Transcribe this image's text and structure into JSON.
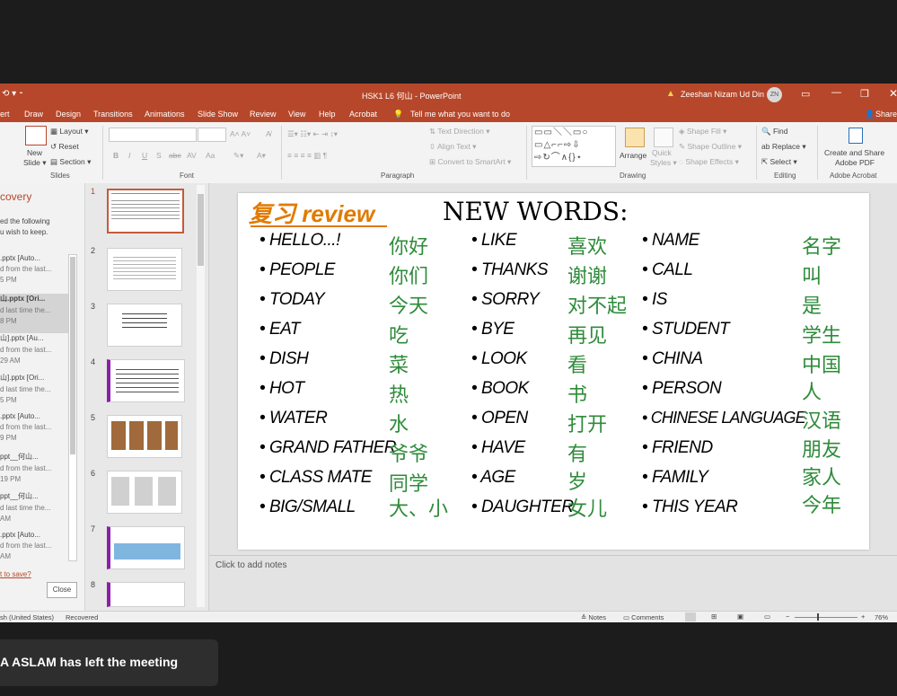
{
  "titlebar": {
    "doc_title": "HSK1 L6 何山 - PowerPoint",
    "user_name": "Zeeshan Nizam Ud Din",
    "user_initials": "ZN",
    "warning_icon": "warning-icon"
  },
  "tabs": [
    "ert",
    "Draw",
    "Design",
    "Transitions",
    "Animations",
    "Slide Show",
    "Review",
    "View",
    "Help",
    "Acrobat"
  ],
  "tell_me": "Tell me what you want to do",
  "share": "Share",
  "ribbon": {
    "slides": {
      "new_slide": "New\nSlide",
      "layout": "Layout",
      "reset": "Reset",
      "section": "Section",
      "label": "Slides"
    },
    "font": {
      "label": "Font",
      "buttons": [
        "B",
        "I",
        "U",
        "S",
        "abc",
        "AV",
        "Aa"
      ]
    },
    "paragraph": {
      "label": "Paragraph",
      "text_direction": "Text Direction",
      "align_text": "Align Text",
      "convert": "Convert to SmartArt"
    },
    "drawing": {
      "label": "Drawing",
      "arrange": "Arrange",
      "quick_styles": "Quick\nStyles",
      "shape_fill": "Shape Fill",
      "shape_outline": "Shape Outline",
      "shape_effects": "Shape Effects"
    },
    "editing": {
      "label": "Editing",
      "find": "Find",
      "replace": "Replace",
      "select": "Select"
    },
    "acrobat": {
      "label": "Adobe Acrobat",
      "create": "Create and Share\nAdobe PDF"
    }
  },
  "recovery": {
    "title": "covery",
    "desc": "ed the following\nu wish to keep.",
    "items": [
      {
        "name": ".pptx  [Auto...",
        "sub": "d from the last...",
        "time": "5 PM"
      },
      {
        "name": "山.pptx  [Ori...",
        "sub": "d last time the...",
        "time": "8 PM"
      },
      {
        "name": "山].pptx  [Au...",
        "sub": "d from the last...",
        "time": "29 AM"
      },
      {
        "name": "山].pptx  [Ori...",
        "sub": "d last time the...",
        "time": "5 PM"
      },
      {
        "name": ".pptx  [Auto...",
        "sub": "d from the last...",
        "time": "9 PM"
      },
      {
        "name": "ppt__何山...",
        "sub": "d from the last...",
        "time": "19 PM"
      },
      {
        "name": "ppt__何山...",
        "sub": "d last time the...",
        "time": "AM"
      },
      {
        "name": ".pptx  [Auto...",
        "sub": "d from the last...",
        "time": "AM"
      }
    ],
    "link": "t to save?",
    "close": "Close"
  },
  "thumbnails": [
    "1",
    "2",
    "3",
    "4",
    "5",
    "6",
    "7",
    "8"
  ],
  "slide": {
    "review_label": "复习 review",
    "heading": "NEW WORDS:",
    "col1": [
      {
        "en": "HELLO...!",
        "zh": "你好"
      },
      {
        "en": "PEOPLE",
        "zh": "你们"
      },
      {
        "en": "TODAY",
        "zh": "今天"
      },
      {
        "en": "EAT",
        "zh": "吃"
      },
      {
        "en": "DISH",
        "zh": "菜"
      },
      {
        "en": "HOT",
        "zh": "热"
      },
      {
        "en": "WATER",
        "zh": "水"
      },
      {
        "en": "GRAND FATHER",
        "zh": "爷爷"
      },
      {
        "en": "CLASS MATE",
        "zh": "同学"
      },
      {
        "en": "BIG/SMALL",
        "zh": "大、小"
      }
    ],
    "col2": [
      {
        "en": "LIKE",
        "zh": "喜欢"
      },
      {
        "en": "THANKS",
        "zh": "谢谢"
      },
      {
        "en": "SORRY",
        "zh": "对不起"
      },
      {
        "en": "BYE",
        "zh": "再见"
      },
      {
        "en": "LOOK",
        "zh": "看"
      },
      {
        "en": "BOOK",
        "zh": "书"
      },
      {
        "en": "OPEN",
        "zh": "打开"
      },
      {
        "en": "HAVE",
        "zh": "有"
      },
      {
        "en": "AGE",
        "zh": "岁"
      },
      {
        "en": "DAUGHTER",
        "zh": "女儿"
      }
    ],
    "col3": [
      {
        "en": "NAME",
        "zh": "名字"
      },
      {
        "en": "CALL",
        "zh": "叫"
      },
      {
        "en": "IS",
        "zh": "是"
      },
      {
        "en": "STUDENT",
        "zh": "学生"
      },
      {
        "en": "CHINA",
        "zh": "中国"
      },
      {
        "en": "PERSON",
        "zh": "人"
      },
      {
        "en": "CHINESE LANGUAGE",
        "zh": "汉语"
      },
      {
        "en": "FRIEND",
        "zh": "朋友"
      },
      {
        "en": "FAMILY",
        "zh": "家人"
      },
      {
        "en": "THIS YEAR",
        "zh": "今年"
      }
    ]
  },
  "notes_placeholder": "Click to add notes",
  "status": {
    "language": "sh (United States)",
    "recovered": "Recovered",
    "notes": "Notes",
    "comments": "Comments",
    "zoom": "76%"
  },
  "toast": "A ASLAM has left the meeting",
  "colors": {
    "accent": "#b7472a",
    "chinese_green": "#2e8b3a",
    "review_orange": "#e07b00"
  }
}
